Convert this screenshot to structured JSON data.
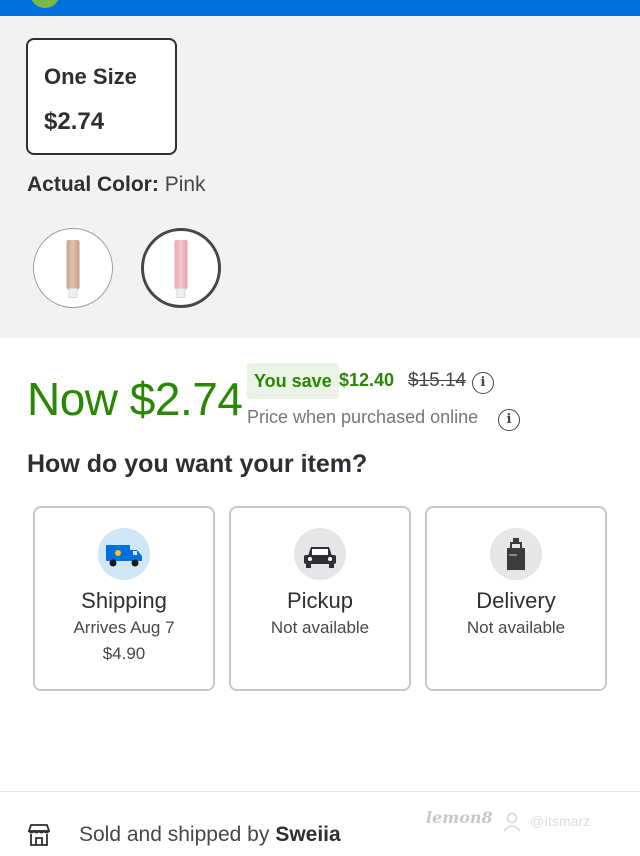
{
  "product": {
    "size_option": {
      "name": "One Size",
      "price": "$2.74"
    },
    "color": {
      "label": "Actual Color:",
      "value": "Pink"
    },
    "swatches": [
      {
        "name": "Nude",
        "color": "#d9b59b"
      },
      {
        "name": "Pink",
        "color": "#f0b7c0",
        "selected": true
      }
    ]
  },
  "pricing": {
    "now_price": "Now $2.74",
    "you_save_label": "You save",
    "save_amount": "$12.40",
    "was_price": "$15.14",
    "online_note": "Price when purchased online",
    "accent_color": "#2a8703"
  },
  "fulfillment": {
    "question": "How do you want your item?",
    "options": [
      {
        "title": "Shipping",
        "line1": "Arrives Aug 7",
        "line2": "$4.90",
        "icon": "truck-icon"
      },
      {
        "title": "Pickup",
        "line1": "Not available",
        "line2": "",
        "icon": "car-icon"
      },
      {
        "title": "Delivery",
        "line1": "Not available",
        "line2": "",
        "icon": "bag-icon"
      }
    ]
  },
  "seller": {
    "prefix": "Sold and shipped by",
    "name": "Sweiia"
  },
  "watermark": {
    "brand": "lemon8",
    "username": "@Itsmarz"
  },
  "brand_color": "#0071dc"
}
